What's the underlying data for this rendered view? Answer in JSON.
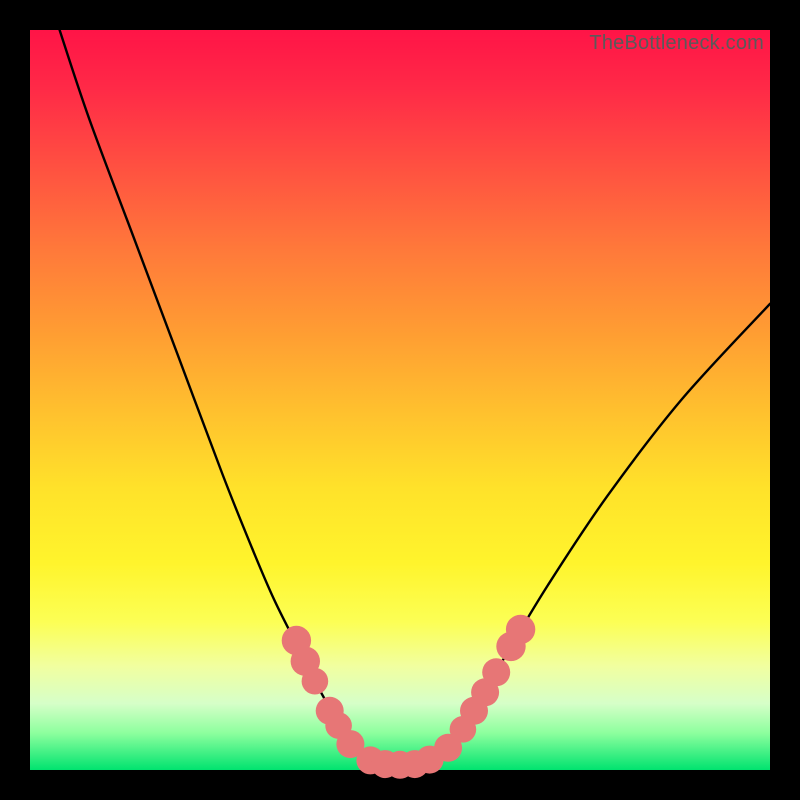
{
  "watermark": "TheBottleneck.com",
  "colors": {
    "frame_border": "#000000",
    "curve_stroke": "#000000",
    "bead_fill": "#e77676",
    "gradient_top": "#ff1447",
    "gradient_bottom": "#00e36f"
  },
  "chart_data": {
    "type": "line",
    "title": "",
    "xlabel": "",
    "ylabel": "",
    "xlim": [
      0,
      100
    ],
    "ylim": [
      0,
      100
    ],
    "note": "x and y are percentages of plot-area width/height; y=0 at top, curve minimum (optimal zone) at bottom",
    "series": [
      {
        "name": "bottleneck-curve",
        "x": [
          4,
          8,
          14,
          20,
          26,
          30,
          33,
          36,
          38.5,
          41,
          43,
          45,
          47,
          49,
          51,
          53,
          55,
          57,
          60,
          64,
          70,
          78,
          88,
          100
        ],
        "y": [
          0,
          12,
          28,
          44,
          60,
          70,
          77,
          83,
          88,
          92.5,
          96,
          98,
          99,
          99.3,
          99.3,
          99,
          98,
          96,
          92,
          85,
          75,
          63,
          50,
          37
        ]
      }
    ],
    "markers": {
      "name": "beads",
      "points": [
        {
          "x": 36.0,
          "y": 82.5,
          "r": 1.3
        },
        {
          "x": 37.2,
          "y": 85.3,
          "r": 1.3
        },
        {
          "x": 38.5,
          "y": 88.0,
          "r": 1.1
        },
        {
          "x": 40.5,
          "y": 92.0,
          "r": 1.2
        },
        {
          "x": 41.7,
          "y": 94.0,
          "r": 1.1
        },
        {
          "x": 43.3,
          "y": 96.5,
          "r": 1.2
        },
        {
          "x": 46.0,
          "y": 98.7,
          "r": 1.2
        },
        {
          "x": 48.0,
          "y": 99.2,
          "r": 1.2
        },
        {
          "x": 50.0,
          "y": 99.3,
          "r": 1.2
        },
        {
          "x": 52.0,
          "y": 99.2,
          "r": 1.2
        },
        {
          "x": 54.0,
          "y": 98.6,
          "r": 1.2
        },
        {
          "x": 56.5,
          "y": 97.0,
          "r": 1.2
        },
        {
          "x": 58.5,
          "y": 94.5,
          "r": 1.1
        },
        {
          "x": 60.0,
          "y": 92.0,
          "r": 1.2
        },
        {
          "x": 61.5,
          "y": 89.5,
          "r": 1.2
        },
        {
          "x": 63.0,
          "y": 86.8,
          "r": 1.2
        },
        {
          "x": 65.0,
          "y": 83.3,
          "r": 1.3
        },
        {
          "x": 66.3,
          "y": 81.0,
          "r": 1.3
        }
      ]
    }
  }
}
